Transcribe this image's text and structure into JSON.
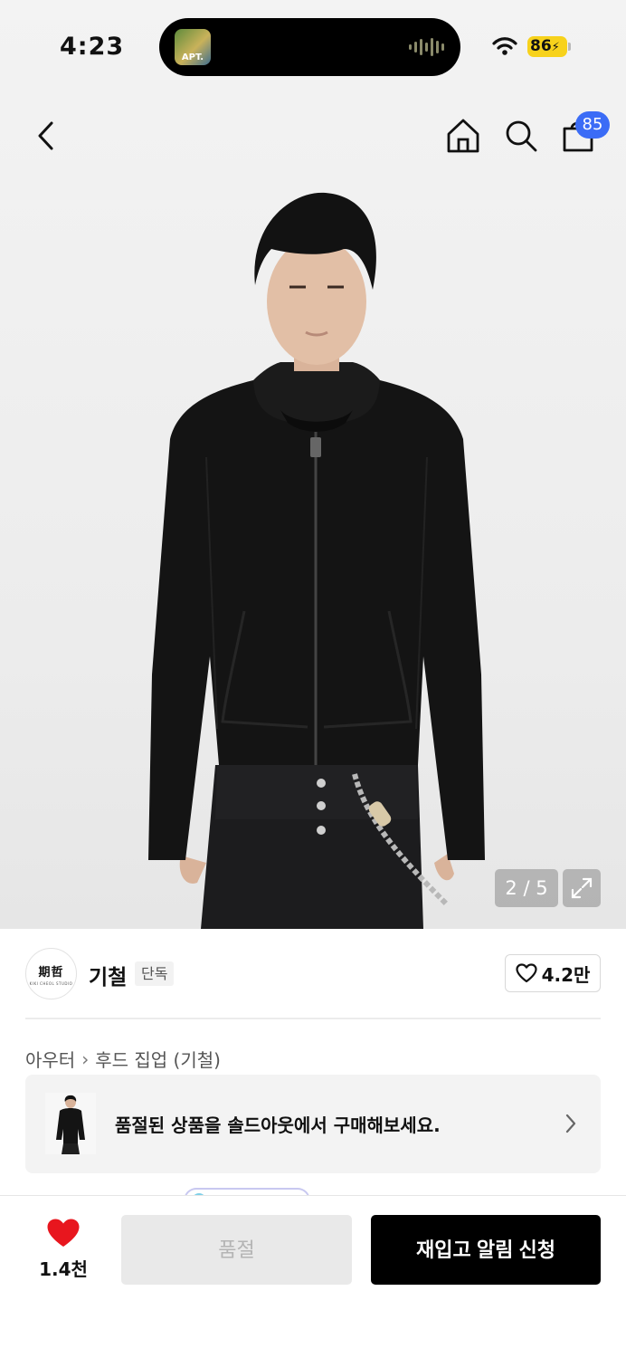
{
  "status_bar": {
    "time": "4:23",
    "now_playing_art_label": "APT.",
    "battery": "86"
  },
  "nav": {
    "cart_badge": "85",
    "icons": [
      "back-icon",
      "home-icon",
      "search-icon",
      "cart-icon"
    ]
  },
  "gallery": {
    "counter": "2 / 5",
    "current_image": 2,
    "total_images": 5
  },
  "brand": {
    "logo_text": "期哲",
    "logo_subtext": "KIKI CHEOL STUDIO",
    "name": "기철",
    "tag": "단독",
    "likes": "4.2만"
  },
  "breadcrumb": {
    "category": "아우터",
    "subcategory": "후드 집업 (기철)"
  },
  "soldout_banner": {
    "text": "품절된 상품을 솔드아웃에서 구매해보세요."
  },
  "bottom_bar": {
    "wish_count": "1.4천",
    "soldout_label": "품절",
    "restock_label": "재입고 알림 신청"
  },
  "colors": {
    "accent_blue": "#3b6cf6",
    "heart_red": "#e8161e",
    "battery_yellow": "#f7d21c",
    "primary_black": "#000000"
  }
}
